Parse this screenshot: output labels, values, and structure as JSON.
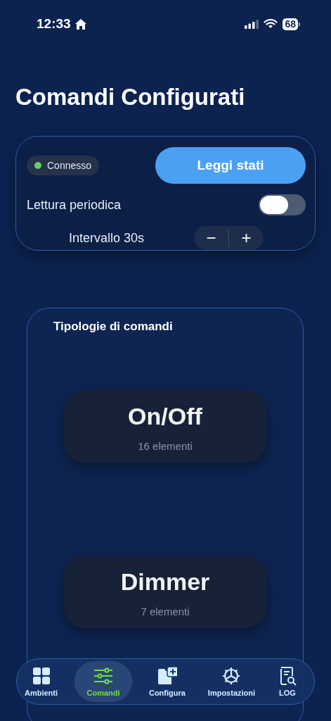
{
  "status_bar": {
    "time": "12:33",
    "battery": "68"
  },
  "title": "Comandi Configurati",
  "control_card": {
    "connection": {
      "label": "Connesso",
      "connected": true
    },
    "read_button": "Leggi stati",
    "periodic_read": {
      "label": "Lettura periodica",
      "on": false
    },
    "interval": {
      "label": "Intervallo 30s",
      "decrement": "−",
      "increment": "+"
    }
  },
  "types_panel": {
    "title": "Tipologie di comandi",
    "items": [
      {
        "name": "On/Off",
        "count": "16 elementi"
      },
      {
        "name": "Dimmer",
        "count": "7 elementi"
      }
    ]
  },
  "tab_bar": [
    {
      "label": "Ambienti",
      "selected": false
    },
    {
      "label": "Comandi",
      "selected": true
    },
    {
      "label": "Configura",
      "selected": false
    },
    {
      "label": "Impostazioni",
      "selected": false
    },
    {
      "label": "LOG",
      "selected": false
    }
  ]
}
